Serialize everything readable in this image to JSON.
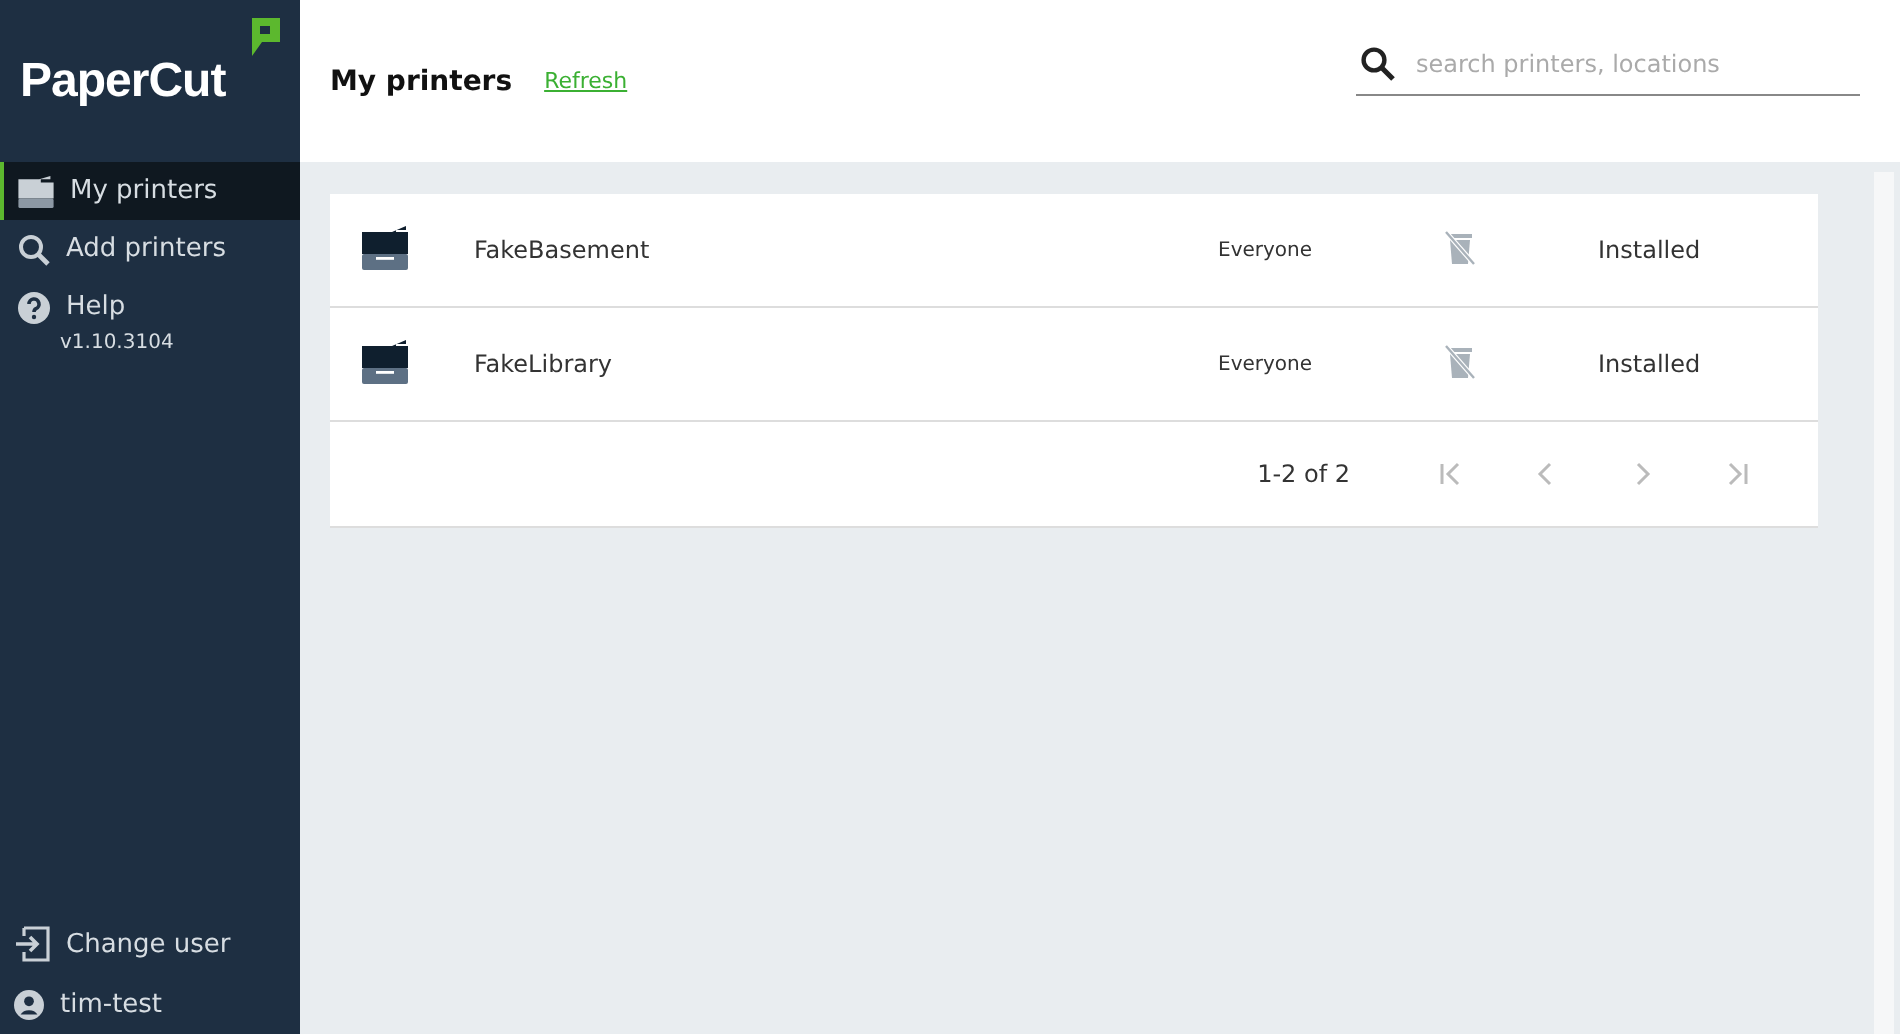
{
  "logo": {
    "text": "PaperCut"
  },
  "sidebar": {
    "items": [
      {
        "kind": "printers",
        "label": "My printers",
        "selected": true
      },
      {
        "kind": "search",
        "label": "Add printers",
        "selected": false
      },
      {
        "kind": "help",
        "label": "Help",
        "selected": false
      }
    ],
    "version": "v1.10.3104",
    "footer": [
      {
        "kind": "change-user",
        "label": "Change user"
      },
      {
        "kind": "user",
        "label": "tim-test"
      }
    ]
  },
  "header": {
    "title": "My printers",
    "refresh": "Refresh",
    "search": {
      "placeholder": "search printers, locations"
    }
  },
  "table": {
    "rows": [
      {
        "name": "FakeBasement",
        "access": "Everyone",
        "status": "Installed"
      },
      {
        "name": "FakeLibrary",
        "access": "Everyone",
        "status": "Installed"
      }
    ],
    "pagination": {
      "range": "1-2 of 2",
      "buttons": [
        {
          "kind": "first",
          "disabled": true
        },
        {
          "kind": "prev",
          "disabled": true
        },
        {
          "kind": "next",
          "disabled": true
        },
        {
          "kind": "last",
          "disabled": true
        }
      ]
    }
  }
}
